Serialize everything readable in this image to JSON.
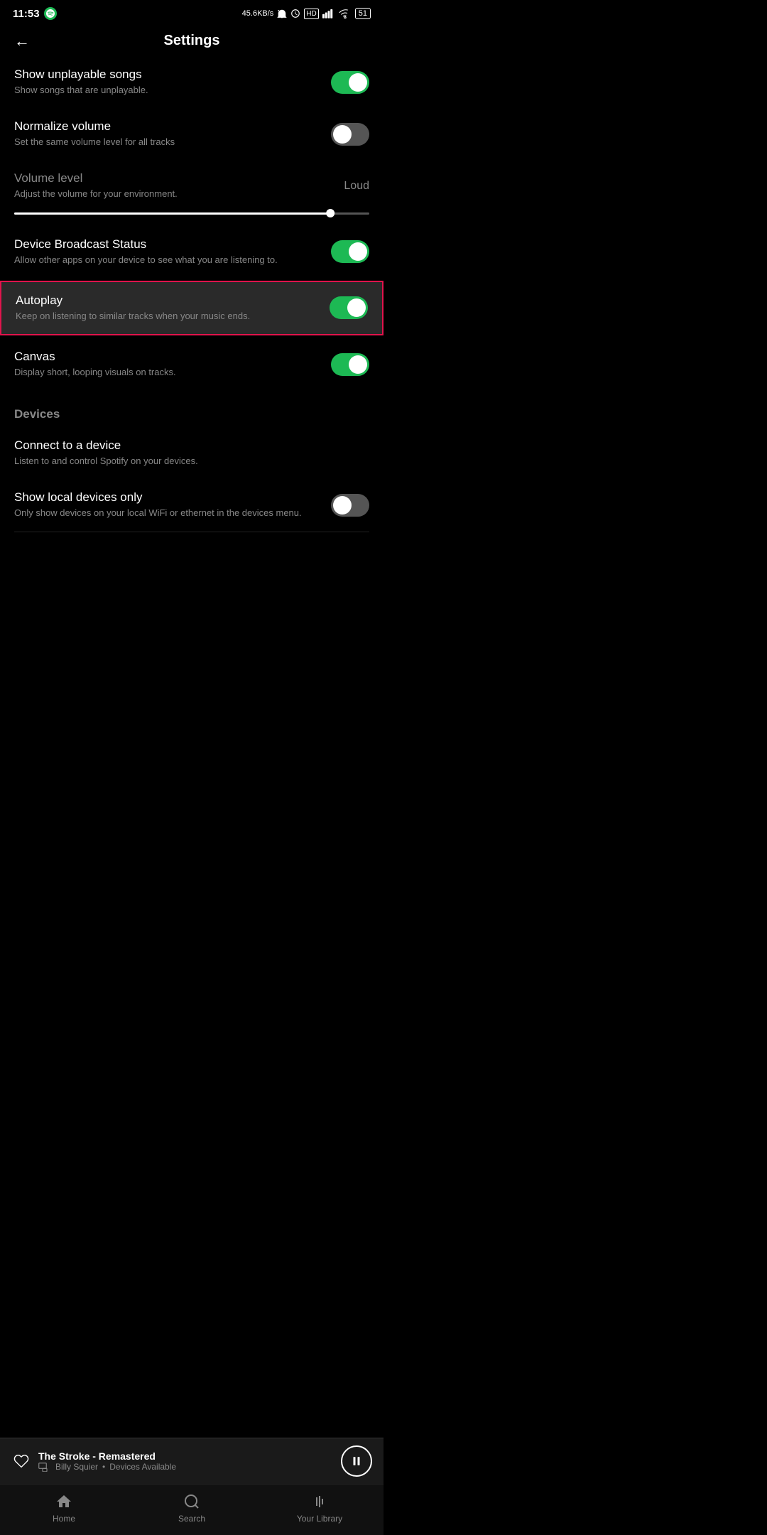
{
  "statusBar": {
    "time": "11:53",
    "speed": "45.6KB/s",
    "battery": "51"
  },
  "header": {
    "title": "Settings",
    "backLabel": "←"
  },
  "settings": [
    {
      "id": "show-unplayable",
      "title": "Show unplayable songs",
      "desc": "Show songs that are unplayable.",
      "toggleState": "on",
      "highlighted": false
    },
    {
      "id": "normalize-volume",
      "title": "Normalize volume",
      "desc": "Set the same volume level for all tracks",
      "toggleState": "off",
      "highlighted": false
    },
    {
      "id": "volume-level",
      "title": "Volume level",
      "desc": "Adjust the volume for your environment.",
      "toggleState": null,
      "value": "Loud",
      "highlighted": false
    },
    {
      "id": "device-broadcast",
      "title": "Device Broadcast Status",
      "desc": "Allow other apps on your device to see what you are listening to.",
      "toggleState": "on",
      "highlighted": false
    },
    {
      "id": "autoplay",
      "title": "Autoplay",
      "desc": "Keep on listening to similar tracks when your music ends.",
      "toggleState": "on",
      "highlighted": true
    },
    {
      "id": "canvas",
      "title": "Canvas",
      "desc": "Display short, looping visuals on tracks.",
      "toggleState": "on",
      "highlighted": false
    }
  ],
  "devicesSection": {
    "label": "Devices",
    "items": [
      {
        "id": "connect-device",
        "title": "Connect to a device",
        "desc": "Listen to and control Spotify on your devices.",
        "toggleState": null
      },
      {
        "id": "local-devices",
        "title": "Show local devices only",
        "desc": "Only show devices on your local WiFi or ethernet in the devices menu.",
        "toggleState": "off"
      }
    ]
  },
  "nowPlaying": {
    "title": "The Stroke - Remastered",
    "artist": "Billy Squier",
    "devices": "Devices Available"
  },
  "bottomNav": [
    {
      "id": "home",
      "label": "Home",
      "active": false
    },
    {
      "id": "search",
      "label": "Search",
      "active": false
    },
    {
      "id": "library",
      "label": "Your Library",
      "active": false
    }
  ]
}
